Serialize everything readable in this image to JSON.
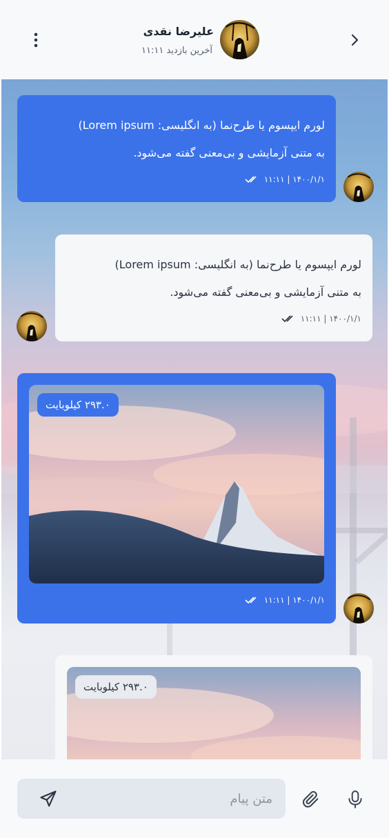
{
  "header": {
    "contact_name": "علیرضا نقدی",
    "status": "آخرین بازدید ۱۱:۱۱",
    "back_icon": "chevron-right-icon",
    "menu_icon": "more-vertical-icon"
  },
  "messages": [
    {
      "type": "text",
      "direction": "outgoing",
      "line1": "لورم ایپسوم یا طرح‌نما (به انگلیسی: Lorem ipsum)",
      "line2": "به متنی آزمایشی و بی‌معنی گفته می‌شود.",
      "timestamp": "۱۴۰۰/۱/۱ | ۱۱:۱۱",
      "status_icon": "double-check-icon"
    },
    {
      "type": "text",
      "direction": "incoming",
      "line1": "لورم ایپسوم یا طرح‌نما (به انگلیسی: Lorem ipsum)",
      "line2": "به متنی آزمایشی و بی‌معنی گفته می‌شود.",
      "timestamp": "۱۴۰۰/۱/۱ | ۱۱:۱۱",
      "status_icon": "double-check-icon"
    },
    {
      "type": "image",
      "direction": "outgoing",
      "file_size": "۲۹۳.۰ کیلوبایت",
      "timestamp": "۱۴۰۰/۱/۱ | ۱۱:۱۱",
      "status_icon": "double-check-icon"
    },
    {
      "type": "image",
      "direction": "incoming",
      "file_size": "۲۹۳.۰ کیلوبایت"
    }
  ],
  "composer": {
    "placeholder": "متن پیام",
    "send_icon": "send-icon",
    "attach_icon": "paperclip-icon",
    "mic_icon": "microphone-icon"
  },
  "colors": {
    "outgoing_bubble": "#3b72ea",
    "incoming_bubble": "#f6f7f9",
    "header_bg": "#f7f9fb",
    "input_bg": "#e3e8ef"
  }
}
